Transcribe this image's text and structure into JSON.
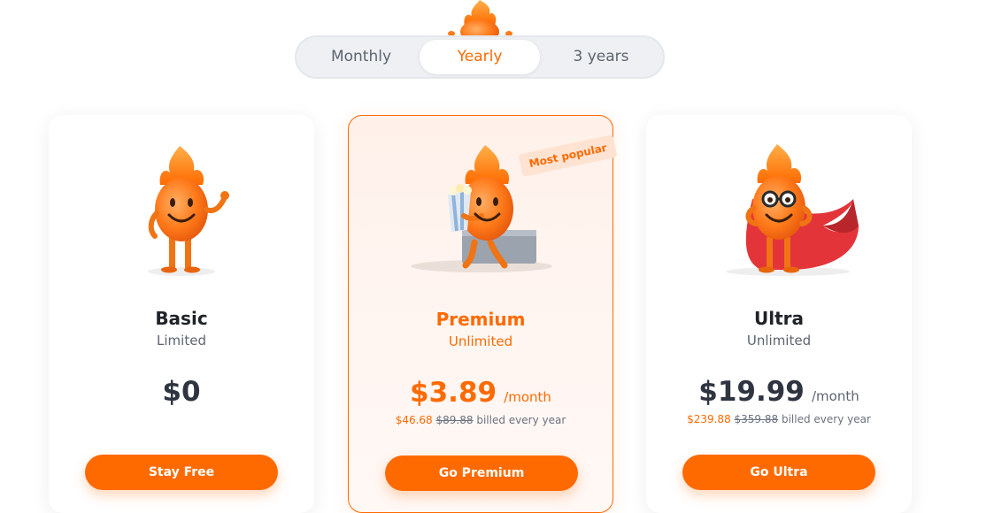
{
  "billing_toggle": {
    "options": [
      "Monthly",
      "Yearly",
      "3 years"
    ],
    "selected": "Yearly"
  },
  "colors": {
    "accent": "#ff6a00",
    "text": "#1f2328",
    "muted": "#5d6470"
  },
  "plans": [
    {
      "name": "Basic",
      "subtitle": "Limited",
      "price": "$0",
      "per": "",
      "billed_new": "",
      "billed_old": "",
      "billed_suffix": "",
      "cta": "Stay Free",
      "illustration": "flame-mascot-waving"
    },
    {
      "name": "Premium",
      "subtitle": "Unlimited",
      "price": "$3.89",
      "per": "/month",
      "billed_new": "$46.68",
      "billed_old": "$89.88",
      "billed_suffix": "billed every year",
      "cta": "Go Premium",
      "badge": "Most popular",
      "illustration": "flame-mascot-popcorn"
    },
    {
      "name": "Ultra",
      "subtitle": "Unlimited",
      "price": "$19.99",
      "per": "/month",
      "billed_new": "$239.88",
      "billed_old": "$359.88",
      "billed_suffix": "billed every year",
      "cta": "Go Ultra",
      "illustration": "flame-mascot-superhero"
    }
  ]
}
